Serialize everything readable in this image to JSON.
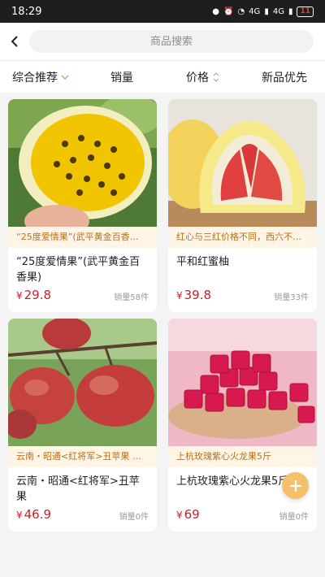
{
  "status_bar": {
    "time": "18:29",
    "signal_1": "4G",
    "signal_2": "4G",
    "battery": "11"
  },
  "search": {
    "placeholder": "商品搜索"
  },
  "sort_tabs": [
    {
      "label": "综合推荐",
      "icon": "chevron-down-icon",
      "active": true
    },
    {
      "label": "销量"
    },
    {
      "label": "价格",
      "icon": "sort-updown-icon"
    },
    {
      "label": "新品优先"
    }
  ],
  "products": [
    {
      "image": "passion-fruit",
      "tag": "“25度爱情果”(武平黄金百香…",
      "name": "“25度爱情果”(武平黄金百香果)",
      "currency": "¥",
      "price": "29.8",
      "sold": "销量58件"
    },
    {
      "image": "pomelo",
      "tag": "红心与三红价格不同，西六不…",
      "name": "平和红蜜柚",
      "currency": "¥",
      "price": "39.8",
      "sold": "销量33件"
    },
    {
      "image": "apple",
      "tag": "云南・昭通<红将军>丑苹果 西…",
      "name": "云南・昭通<红将军>丑苹果",
      "currency": "¥",
      "price": "46.9",
      "sold": "销量0件"
    },
    {
      "image": "dragon-fruit",
      "tag": "上杭玫瑰紫心火龙果5斤",
      "name": "上杭玫瑰紫心火龙果5斤",
      "currency": "¥",
      "price": "69",
      "sold": "销量0件"
    }
  ],
  "fab": {
    "icon": "plus-icon"
  },
  "colors": {
    "accent": "#d4a24a",
    "price": "#c8202a",
    "tag_bg": "#fff5e6",
    "tag_text": "#b8701a",
    "fab": "#f4c06a"
  }
}
